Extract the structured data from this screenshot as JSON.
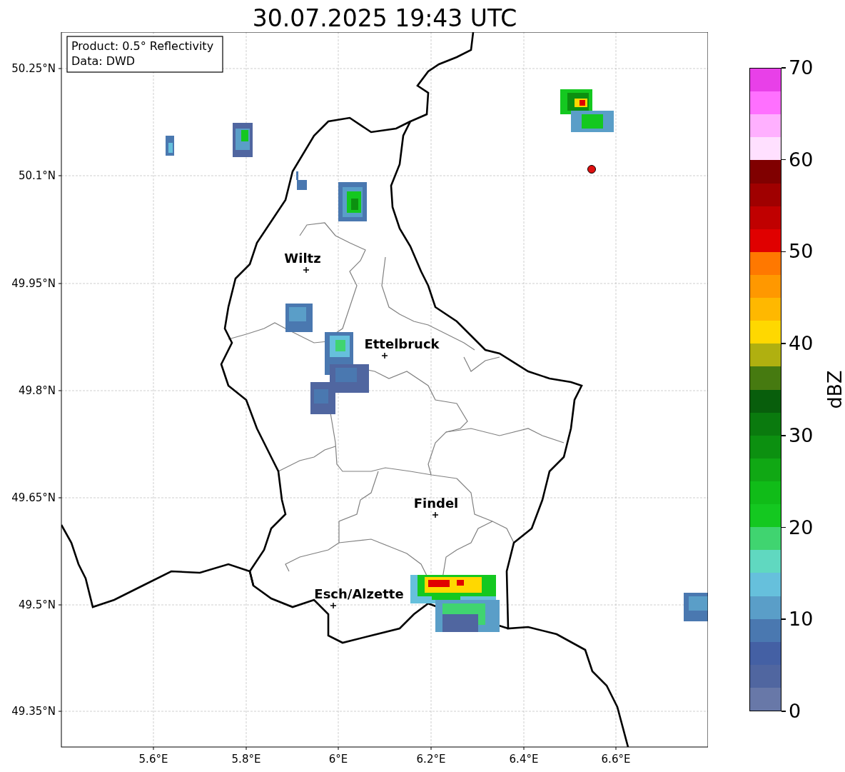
{
  "title": "30.07.2025 19:43 UTC",
  "info_box": [
    "Product: 0.5° Reflectivity",
    "Data: DWD"
  ],
  "map": {
    "lat_ticks": [
      "50.25°N",
      "50.1°N",
      "49.95°N",
      "49.8°N",
      "49.65°N",
      "49.5°N",
      "49.35°N"
    ],
    "lon_ticks": [
      "5.6°E",
      "5.8°E",
      "6°E",
      "6.2°E",
      "6.4°E",
      "6.6°E"
    ],
    "cities": [
      {
        "name": "Wiltz"
      },
      {
        "name": "Ettelbruck"
      },
      {
        "name": "Findel"
      },
      {
        "name": "Esch/Alzette"
      }
    ]
  },
  "colorbar": {
    "label": "dBZ",
    "ticks": [
      "70",
      "60",
      "50",
      "40",
      "30",
      "20",
      "10",
      "0"
    ],
    "segments": [
      {
        "color": "#e840e8"
      },
      {
        "color": "#ff70ff"
      },
      {
        "color": "#ffb0ff"
      },
      {
        "color": "#ffe0ff"
      },
      {
        "color": "#800000"
      },
      {
        "color": "#a00000"
      },
      {
        "color": "#c00000"
      },
      {
        "color": "#e00000"
      },
      {
        "color": "#ff7800"
      },
      {
        "color": "#ff9800"
      },
      {
        "color": "#ffb800"
      },
      {
        "color": "#ffd800"
      },
      {
        "color": "#b0b010"
      },
      {
        "color": "#467a10"
      },
      {
        "color": "#085e0c"
      },
      {
        "color": "#0a7a0e"
      },
      {
        "color": "#0c9010"
      },
      {
        "color": "#10a814"
      },
      {
        "color": "#10bc18"
      },
      {
        "color": "#14c820"
      },
      {
        "color": "#40d470"
      },
      {
        "color": "#60d8c0"
      },
      {
        "color": "#66c0dc"
      },
      {
        "color": "#5a9ec8"
      },
      {
        "color": "#4a78b0"
      },
      {
        "color": "#4460a4"
      },
      {
        "color": "#5066a0"
      },
      {
        "color": "#6878a8"
      }
    ]
  }
}
